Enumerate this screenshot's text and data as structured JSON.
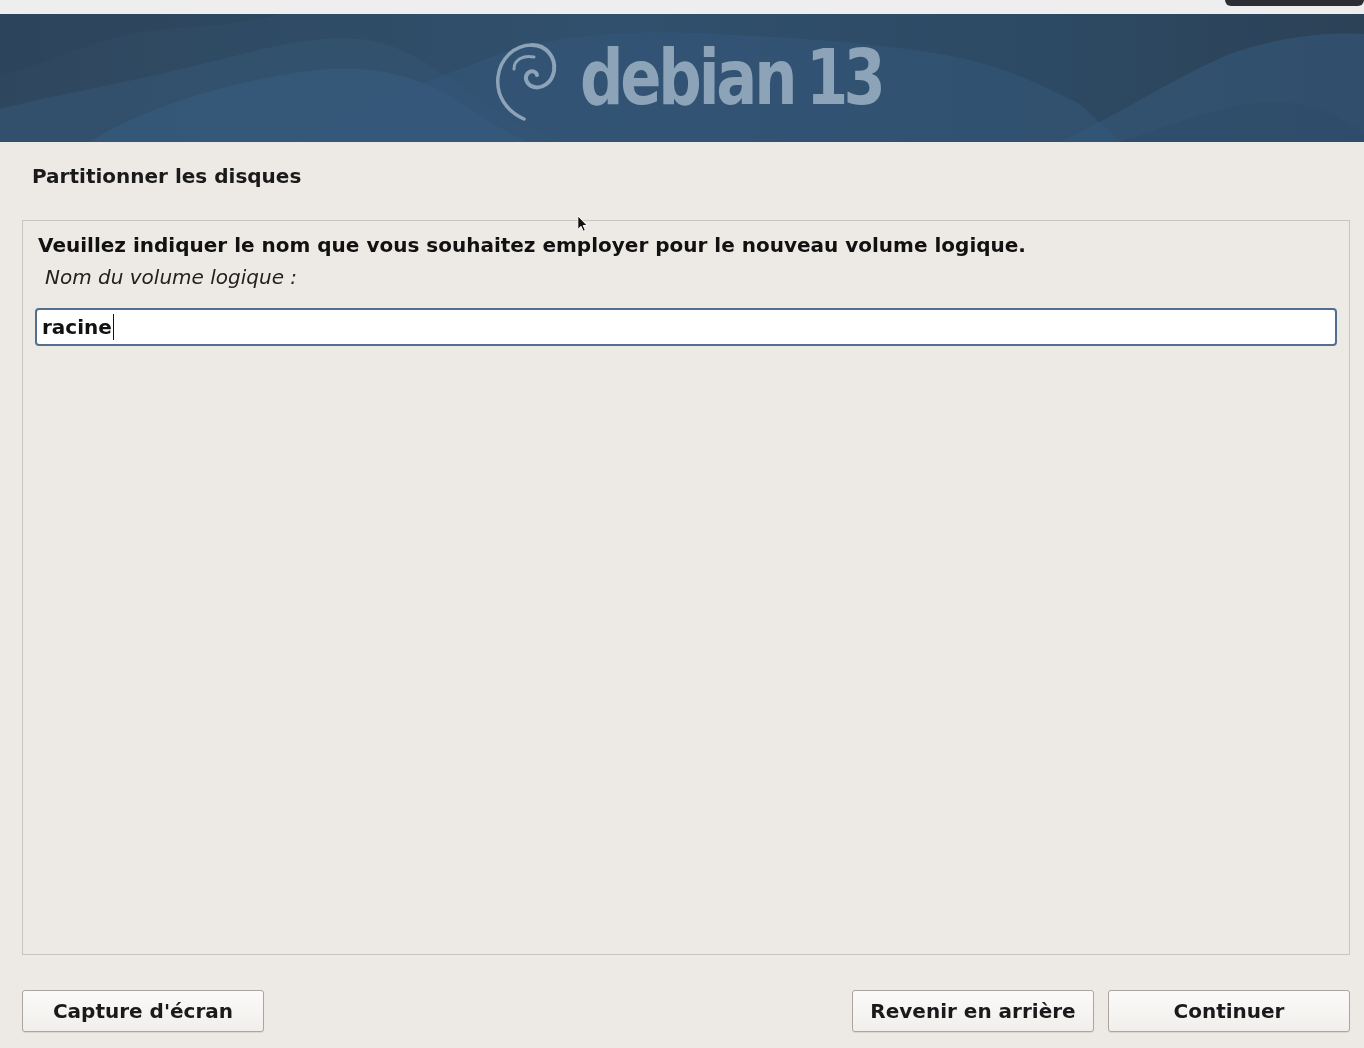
{
  "banner": {
    "logo_text": "debian",
    "version": "13"
  },
  "title": "Partitionner les disques",
  "prompt": {
    "question": "Veuillez indiquer le nom que vous souhaitez employer pour le nouveau volume logique.",
    "label": "Nom du volume logique :"
  },
  "input": {
    "value": "racine",
    "focused": true
  },
  "buttons": [
    {
      "label": "Capture d'écran",
      "kind": "left"
    },
    {
      "label": "Revenir en arrière",
      "kind": "right"
    },
    {
      "label": "Continuer",
      "kind": "right"
    }
  ]
}
